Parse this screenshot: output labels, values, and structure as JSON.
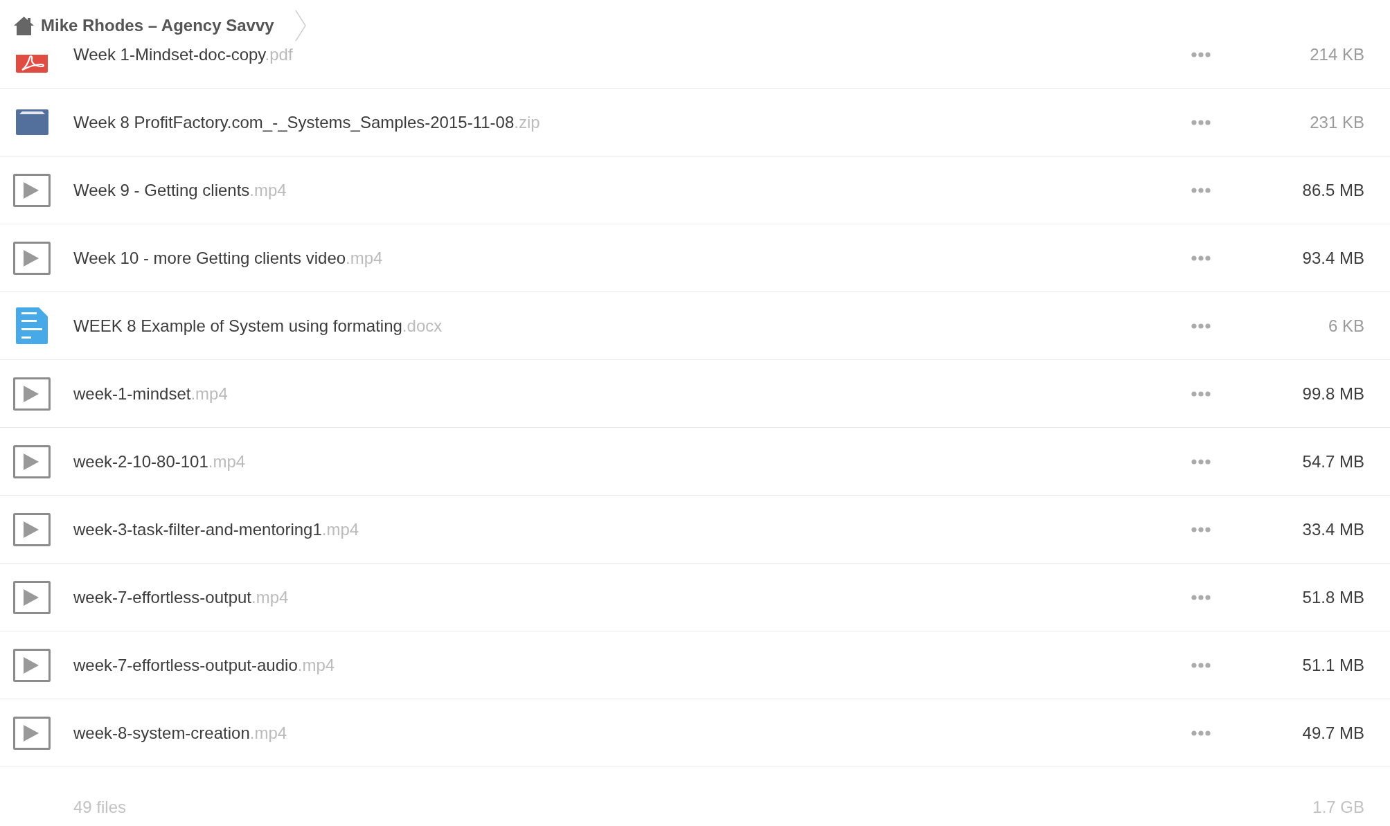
{
  "breadcrumb": {
    "title": "Mike Rhodes – Agency Savvy"
  },
  "files": [
    {
      "kind": "pdf",
      "name": "Week 1-Mindset-doc-copy",
      "extension": ".pdf",
      "size": "214 KB",
      "size_dimmed": true
    },
    {
      "kind": "archive",
      "name": "Week 8 ProfitFactory.com_-_Systems_Samples-2015-11-08",
      "extension": ".zip",
      "size": "231 KB",
      "size_dimmed": true
    },
    {
      "kind": "video",
      "name": "Week 9 - Getting clients",
      "extension": ".mp4",
      "size": "86.5 MB",
      "size_dimmed": false
    },
    {
      "kind": "video",
      "name": "Week 10 - more Getting clients video",
      "extension": ".mp4",
      "size": "93.4 MB",
      "size_dimmed": false
    },
    {
      "kind": "document",
      "name": "WEEK 8 Example of System using formating",
      "extension": ".docx",
      "size": "6 KB",
      "size_dimmed": true
    },
    {
      "kind": "video",
      "name": "week-1-mindset",
      "extension": ".mp4",
      "size": "99.8 MB",
      "size_dimmed": false
    },
    {
      "kind": "video",
      "name": "week-2-10-80-101",
      "extension": ".mp4",
      "size": "54.7 MB",
      "size_dimmed": false
    },
    {
      "kind": "video",
      "name": "week-3-task-filter-and-mentoring1",
      "extension": ".mp4",
      "size": "33.4 MB",
      "size_dimmed": false
    },
    {
      "kind": "video",
      "name": "week-7-effortless-output",
      "extension": ".mp4",
      "size": "51.8 MB",
      "size_dimmed": false
    },
    {
      "kind": "video",
      "name": "week-7-effortless-output-audio",
      "extension": ".mp4",
      "size": "51.1 MB",
      "size_dimmed": false
    },
    {
      "kind": "video",
      "name": "week-8-system-creation",
      "extension": ".mp4",
      "size": "49.7 MB",
      "size_dimmed": false
    }
  ],
  "footer": {
    "file_count": "49 files",
    "total_size": "1.7 GB"
  }
}
